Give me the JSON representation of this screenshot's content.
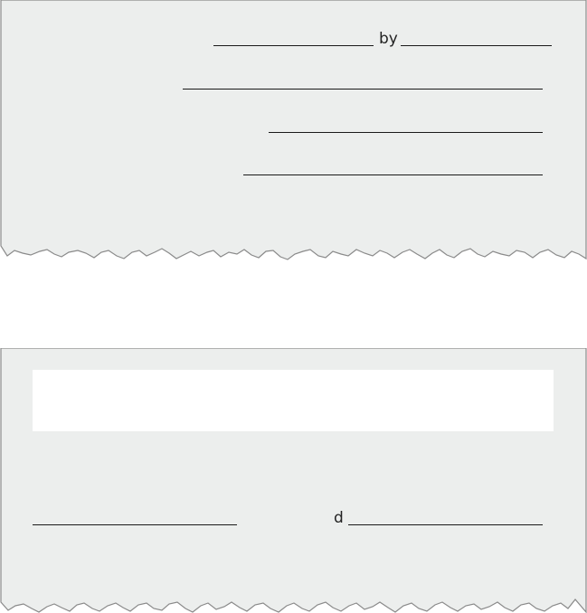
{
  "colors": {
    "panel_fill": "#eceeed",
    "panel_border": "#8a8a8a",
    "line": "#1a1a1a",
    "blank_box": "#ffffff"
  },
  "top_form": {
    "by_label": "by"
  },
  "bottom_form": {
    "d_label": "d"
  }
}
